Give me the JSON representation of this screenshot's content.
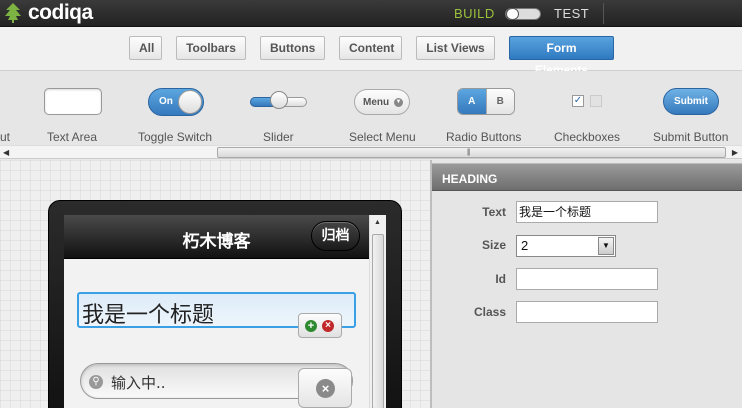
{
  "topbar": {
    "logo_text": "codiqa",
    "mode_build": "BUILD",
    "mode_test": "TEST"
  },
  "categories": [
    {
      "label": "All",
      "active": false
    },
    {
      "label": "Toolbars",
      "active": false
    },
    {
      "label": "Buttons",
      "active": false
    },
    {
      "label": "Content",
      "active": false
    },
    {
      "label": "List Views",
      "active": false
    },
    {
      "label": "Form Elements",
      "active": true
    }
  ],
  "palette": {
    "cut_label": "ut",
    "text_area": "Text Area",
    "toggle_switch": "Toggle Switch",
    "toggle_on": "On",
    "slider": "Slider",
    "select_menu": "Select Menu",
    "select_menu_btn": "Menu",
    "radio_buttons": "Radio Buttons",
    "radio_a": "A",
    "radio_b": "B",
    "checkboxes": "Checkboxes",
    "submit_button": "Submit Button",
    "submit_btn": "Submit"
  },
  "mobile": {
    "header_title": "朽木博客",
    "back_button": "归档",
    "heading_text": "我是一个标题",
    "search_text": "输入中.."
  },
  "properties": {
    "panel_title": "HEADING",
    "text_label": "Text",
    "text_value": "我是一个标题",
    "size_label": "Size",
    "size_value": "2",
    "id_label": "Id",
    "id_value": "",
    "class_label": "Class",
    "class_value": ""
  },
  "colors": {
    "accent": "#3579bd",
    "build_green": "#9bc23c",
    "selection_outline": "#3aa0e6"
  }
}
